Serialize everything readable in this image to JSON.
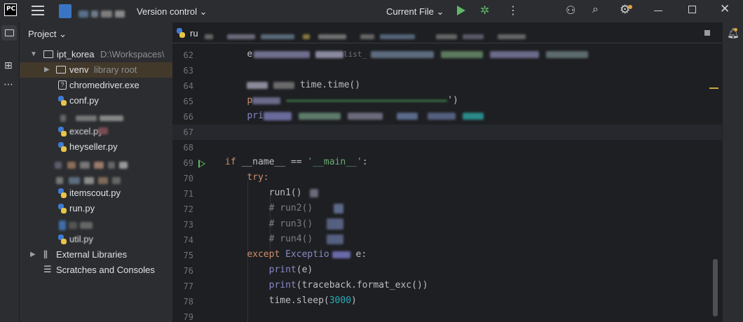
{
  "titlebar": {
    "app_logo": "PC",
    "version_control": "Version control",
    "current_file": "Current File",
    "icons": [
      "hamburger-icon",
      "run-icon",
      "debug-icon",
      "more-icon",
      "add-user-icon",
      "search-icon",
      "settings-icon",
      "minimize-icon",
      "maximize-icon",
      "close-icon"
    ]
  },
  "project": {
    "header": "Project",
    "root_name": "ipt_korea",
    "root_path": "D:\\Workspaces\\",
    "items": [
      {
        "label": "venv",
        "extra": "library root"
      },
      {
        "label": "chromedriver.exe"
      },
      {
        "label": "conf.py"
      },
      {
        "label": "excel.py"
      },
      {
        "label": "heyseller.py"
      },
      {
        "label": "itemscout.py"
      },
      {
        "label": "run.py"
      },
      {
        "label": "util.py"
      }
    ],
    "external_libraries": "External Libraries",
    "scratches": "Scratches and Consoles"
  },
  "editor": {
    "tab_label": "ru",
    "line_numbers": [
      "62",
      "63",
      "64",
      "65",
      "66",
      "67",
      "68",
      "69",
      "70",
      "71",
      "72",
      "73",
      "74",
      "75",
      "76",
      "77",
      "78",
      "79"
    ],
    "visible_code": {
      "l62": "e",
      "l62_b": "list_",
      "l64": "time.time()",
      "l65": "p",
      "l66": "pri",
      "l69_if": "if",
      "l69_name": " __name__ == ",
      "l69_str": "'__main__'",
      "l69_colon": ":",
      "l70": "try:",
      "l71": "run1()",
      "l72": "# run2()",
      "l73": "# run3()",
      "l74": "# run4()",
      "l75_kw": "except",
      "l75_bi": " Exceptio",
      "l75_tail": " e:",
      "l76_fn": "print",
      "l76_args": "(e)",
      "l77_fn": "print",
      "l77_args": "(traceback.format_exc())",
      "l78_pre": "time.sleep(",
      "l78_num": "3000",
      "l78_post": ")"
    }
  },
  "colors": {
    "background": "#1e1f22",
    "panel": "#2b2d30",
    "keyword": "#cf8e6d",
    "string": "#6aab73",
    "number": "#2aacb8",
    "builtin": "#8888c6",
    "run_green": "#5fb865"
  }
}
